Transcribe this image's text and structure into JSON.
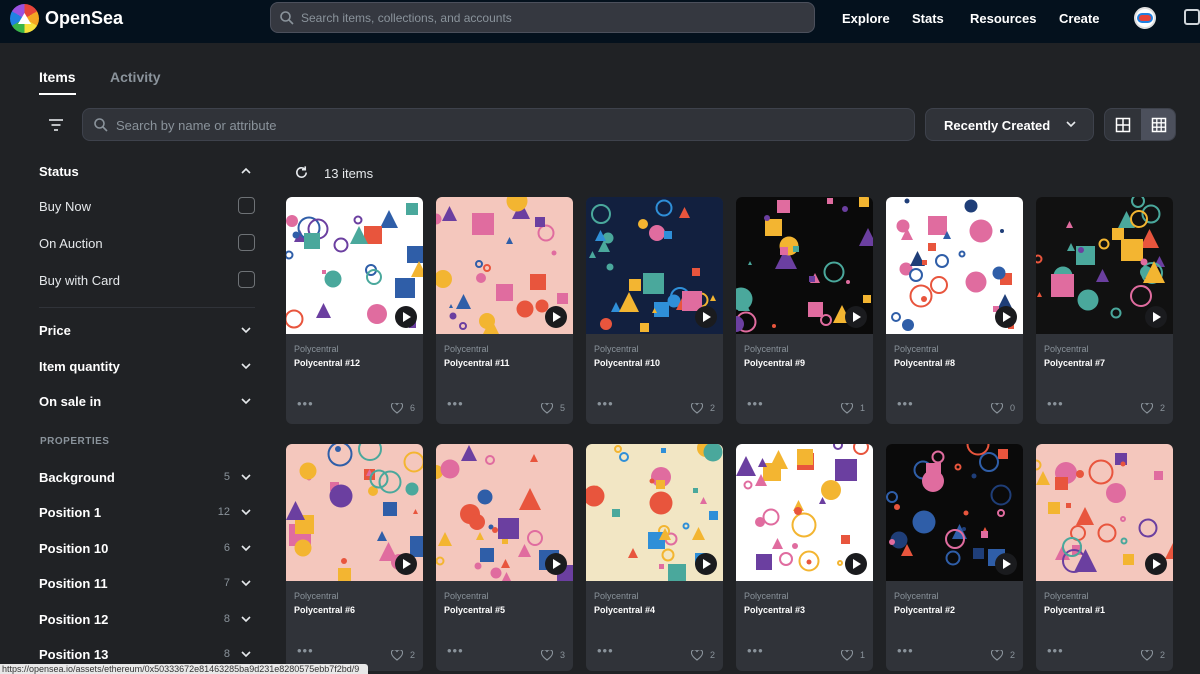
{
  "header": {
    "brand": "OpenSea",
    "search_placeholder": "Search items, collections, and accounts",
    "nav": [
      "Explore",
      "Stats",
      "Resources",
      "Create"
    ]
  },
  "tabs": [
    {
      "label": "Items",
      "active": true
    },
    {
      "label": "Activity",
      "active": false
    }
  ],
  "toolbar": {
    "search_placeholder": "Search by name or attribute",
    "sort_label": "Recently Created"
  },
  "sidebar": {
    "status_title": "Status",
    "status_options": [
      "Buy Now",
      "On Auction",
      "Buy with Card"
    ],
    "filters": [
      "Price",
      "Item quantity",
      "On sale in"
    ],
    "properties_title": "PROPERTIES",
    "properties": [
      {
        "label": "Background",
        "count": "5"
      },
      {
        "label": "Position 1",
        "count": "12"
      },
      {
        "label": "Position 10",
        "count": "6"
      },
      {
        "label": "Position 11",
        "count": "7"
      },
      {
        "label": "Position 12",
        "count": "8"
      },
      {
        "label": "Position 13",
        "count": "8"
      }
    ]
  },
  "results": {
    "count_label": "13 items"
  },
  "items": [
    {
      "collection": "Polycentral",
      "name": "Polycentral #12",
      "likes": "6",
      "bg": "#ffffff"
    },
    {
      "collection": "Polycentral",
      "name": "Polycentral #11",
      "likes": "5",
      "bg": "#f4c7bd"
    },
    {
      "collection": "Polycentral",
      "name": "Polycentral #10",
      "likes": "2",
      "bg": "#12203f"
    },
    {
      "collection": "Polycentral",
      "name": "Polycentral #9",
      "likes": "1",
      "bg": "#0a0a0a"
    },
    {
      "collection": "Polycentral",
      "name": "Polycentral #8",
      "likes": "0",
      "bg": "#ffffff"
    },
    {
      "collection": "Polycentral",
      "name": "Polycentral #7",
      "likes": "2",
      "bg": "#111111"
    },
    {
      "collection": "Polycentral",
      "name": "Polycentral #6",
      "likes": "2",
      "bg": "#f4c7bd"
    },
    {
      "collection": "Polycentral",
      "name": "Polycentral #5",
      "likes": "3",
      "bg": "#f4c7bd"
    },
    {
      "collection": "Polycentral",
      "name": "Polycentral #4",
      "likes": "2",
      "bg": "#f2e6c4"
    },
    {
      "collection": "Polycentral",
      "name": "Polycentral #3",
      "likes": "1",
      "bg": "#ffffff"
    },
    {
      "collection": "Polycentral",
      "name": "Polycentral #2",
      "likes": "2",
      "bg": "#0a0a0a"
    },
    {
      "collection": "Polycentral",
      "name": "Polycentral #1",
      "likes": "2",
      "bg": "#f4c7bd"
    }
  ],
  "status_bar_url": "https://opensea.io/assets/ethereum/0x50333672e81463285ba9d231e8280575ebb7f2bd/9",
  "colors": {
    "accent_red": "#e8553d",
    "accent_blue": "#2f5ea8",
    "accent_teal": "#4aa89c",
    "accent_purple": "#6b3fa0",
    "accent_yellow": "#f3b531",
    "accent_pink": "#e06c9f"
  }
}
